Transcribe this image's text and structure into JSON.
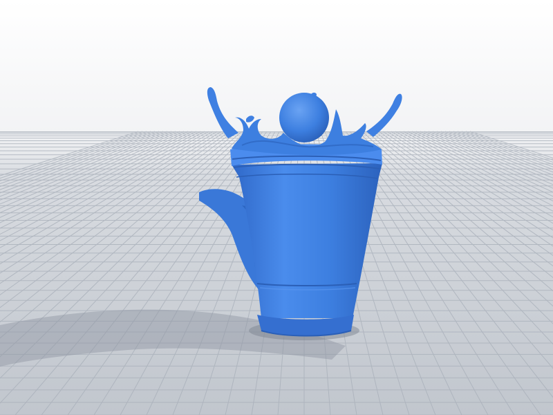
{
  "scene": {
    "subject": "blue-3d-cup-model",
    "colors": {
      "model": "#3d7fe0",
      "model_light": "#5a97f0",
      "model_dark": "#2a5fb8",
      "shadow": "#9aa3b0",
      "grid_line": "#a9b0ba",
      "plate_far": "#bcc2ca",
      "plate_near": "#9ea5b0"
    }
  }
}
